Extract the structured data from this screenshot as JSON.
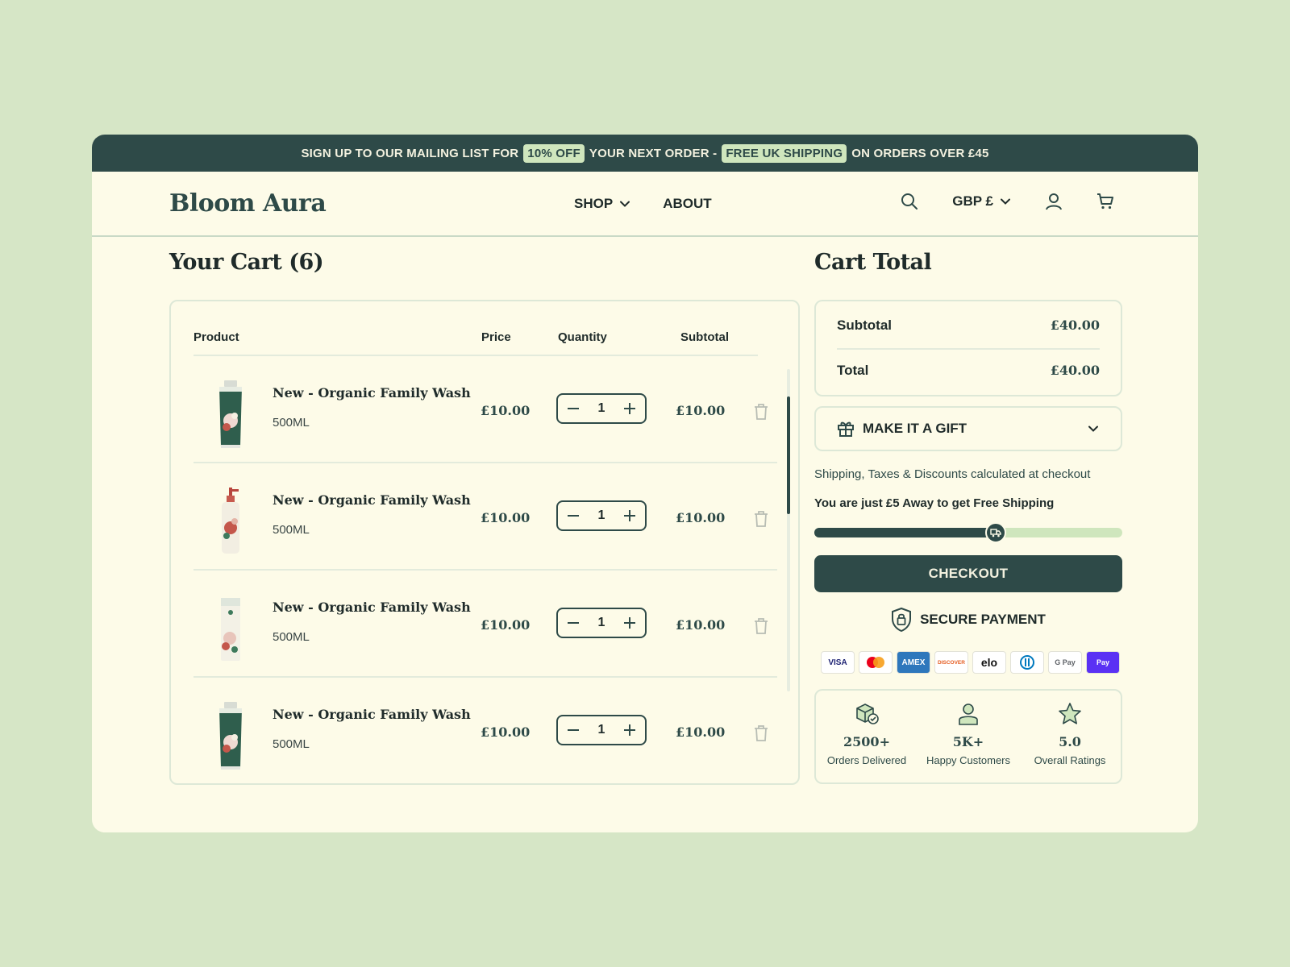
{
  "promo": {
    "text_1": "SIGN UP TO OUR MAILING LIST FOR",
    "chip_1": "10% OFF",
    "text_2": "YOUR NEXT ORDER -",
    "chip_2": "FREE UK SHIPPING",
    "text_3": "ON ORDERS OVER £45"
  },
  "header": {
    "logo": "Bloom Aura",
    "nav": {
      "shop": "SHOP",
      "about": "ABOUT"
    },
    "currency": "GBP £",
    "icons": [
      "search-icon",
      "chevron-down-icon",
      "user-icon",
      "cart-icon"
    ]
  },
  "cart": {
    "title": "Your Cart (6)",
    "columns": {
      "product": "Product",
      "price": "Price",
      "quantity": "Quantity",
      "subtotal": "Subtotal"
    },
    "items": [
      {
        "name": "New - Organic Family Wash",
        "size": "500ML",
        "price": "£10.00",
        "quantity": "1",
        "subtotal": "£10.00",
        "thumb": "tube"
      },
      {
        "name": "New - Organic Family Wash",
        "size": "500ML",
        "price": "£10.00",
        "quantity": "1",
        "subtotal": "£10.00",
        "thumb": "pump"
      },
      {
        "name": "New - Organic Family Wash",
        "size": "500ML",
        "price": "£10.00",
        "quantity": "1",
        "subtotal": "£10.00",
        "thumb": "box"
      },
      {
        "name": "New - Organic Family Wash",
        "size": "500ML",
        "price": "£10.00",
        "quantity": "1",
        "subtotal": "£10.00",
        "thumb": "tube"
      }
    ]
  },
  "summary": {
    "title": "Cart Total",
    "subtotal_label": "Subtotal",
    "subtotal_value": "£40.00",
    "total_label": "Total",
    "total_value": "£40.00",
    "gift_label": "MAKE IT A GIFT",
    "shipping_note": "Shipping, Taxes & Discounts calculated at checkout",
    "free_shipping_note": "You are just £5 Away to get Free Shipping",
    "free_shipping_progress": 0.59,
    "checkout_label": "CHECKOUT",
    "secure_label": "SECURE PAYMENT",
    "payment_methods": [
      {
        "label": "VISA",
        "bg": "#ffffff",
        "fg": "#1a1f71"
      },
      {
        "label": "",
        "bg": "#ffffff",
        "fg": "#eb001b",
        "icon": "mastercard-icon"
      },
      {
        "label": "AMEX",
        "bg": "#2e77bc",
        "fg": "#ffffff"
      },
      {
        "label": "DISCOVER",
        "bg": "#ffffff",
        "fg": "#e55c20"
      },
      {
        "label": "elo",
        "bg": "#ffffff",
        "fg": "#111111"
      },
      {
        "label": "",
        "bg": "#ffffff",
        "fg": "#0079be",
        "icon": "diners-icon"
      },
      {
        "label": "G Pay",
        "bg": "#ffffff",
        "fg": "#5f6368"
      },
      {
        "label": "Pay",
        "bg": "#5a31f4",
        "fg": "#ffffff"
      }
    ],
    "stats": [
      {
        "value": "2500+",
        "caption": "Orders Delivered",
        "icon": "package-check-icon"
      },
      {
        "value": "5K+",
        "caption": "Happy Customers",
        "icon": "customer-icon"
      },
      {
        "value": "5.0",
        "caption": "Overall Ratings",
        "icon": "star-icon"
      }
    ]
  },
  "colors": {
    "page_bg": "#d6e6c6",
    "panel_bg": "#fdfbe8",
    "accent": "#2e4a48",
    "chip": "#cfe6bd"
  }
}
